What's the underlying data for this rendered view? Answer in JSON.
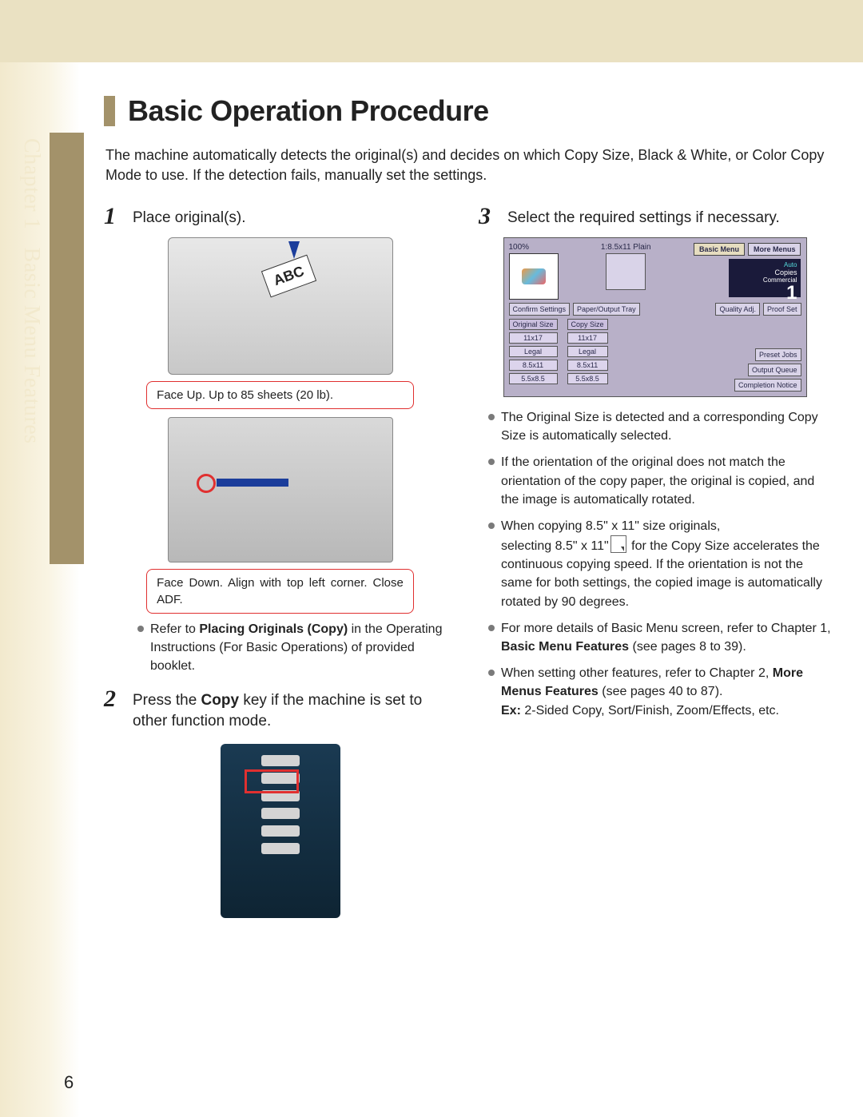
{
  "sidebar": {
    "chapter_label": "Chapter 1",
    "section_label": "Basic Menu Features"
  },
  "title": "Basic Operation Procedure",
  "intro": "The machine automatically detects the original(s) and decides on which Copy Size, Black & White, or Color Copy Mode to use. If the detection fails, manually set the settings.",
  "page_number": "6",
  "steps": {
    "s1": {
      "num": "1",
      "text": "Place original(s).",
      "callout1": "Face Up. Up to 85 sheets (20 lb).",
      "callout2": "Face Down. Align with top left corner. Close ADF.",
      "note_prefix": "Refer to ",
      "note_bold": "Placing Originals (Copy)",
      "note_suffix": " in the Operating Instructions (For Basic Operations) of provided booklet."
    },
    "s2": {
      "num": "2",
      "text_prefix": "Press the ",
      "text_bold": "Copy",
      "text_suffix": " key if the machine is set to other function mode."
    },
    "s3": {
      "num": "3",
      "text": "Select the required settings if necessary.",
      "bullets": {
        "b1": "The Original Size is detected and a corresponding Copy Size is automatically selected.",
        "b2": "If the orientation of the original does not match the orientation of the copy paper, the original is copied, and the image is automatically rotated.",
        "b3a": "When copying 8.5\" x 11\" size originals,",
        "b3b_pre": "selecting 8.5\" x 11\"",
        "b3b_post": " for the Copy Size accelerates the continuous copying speed. If the orientation is not the same for both settings, the copied image is automatically rotated by 90 degrees.",
        "b4_pre": "For more details of Basic Menu screen, refer to Chapter 1, ",
        "b4_bold": "Basic Menu Features",
        "b4_post": " (see pages 8 to 39).",
        "b5_pre": "When setting other features, refer to Chapter 2, ",
        "b5_bold": "More Menus Features",
        "b5_post": " (see pages 40 to 87).",
        "b5_ex_label": "Ex:",
        "b5_ex": " 2-Sided Copy, Sort/Finish, Zoom/Effects, etc."
      }
    }
  },
  "screen": {
    "zoom": "100%",
    "paper_current": "1:8.5x11 Plain",
    "tab_basic": "Basic Menu",
    "tab_more": "More Menus",
    "auto": "Auto",
    "commercial": "Commercial",
    "copies_label": "Copies",
    "copies_value": "1",
    "confirm": "Confirm Settings",
    "paper_tray": "Paper/Output Tray",
    "quality": "Quality Adj.",
    "proof": "Proof Set",
    "orig_hdr": "Original Size",
    "copy_hdr": "Copy Size",
    "sizes": [
      "11x17",
      "Legal",
      "8.5x11",
      "5.5x8.5"
    ],
    "preset": "Preset Jobs",
    "output_queue": "Output Queue",
    "completion": "Completion Notice"
  }
}
